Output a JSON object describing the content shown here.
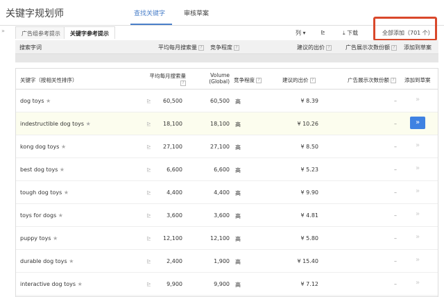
{
  "app": {
    "title": "关键字规划师",
    "nav": [
      "查找关键字",
      "审核草案"
    ]
  },
  "subtabs": [
    "广告组参考提示",
    "关键字参考提示"
  ],
  "toolbar": {
    "columns": "列 ▾",
    "chart_icon": "chart-icon",
    "download": "下载",
    "add_all": "全部添加（701 个）"
  },
  "summary_headers": {
    "term": "搜索字词",
    "avg": "平均每月搜索量",
    "competition": "竞争程度",
    "bid": "建议的出价",
    "share": "广告展示次数份额",
    "add": "添加到草案"
  },
  "table_headers": {
    "keyword": "关键字（按相关性排序）",
    "avg": "平均每月搜索量",
    "volume": "Volume (Global)",
    "competition": "竞争程度",
    "bid": "建议的出价",
    "share": "广告展示次数份额",
    "add": "添加到草案"
  },
  "help": "?",
  "rows": [
    {
      "keyword": "dog toys",
      "avg": "60,500",
      "volume": "60,500",
      "competition": "高",
      "bid": "¥ 8.39",
      "share": "–"
    },
    {
      "keyword": "indestructible dog toys",
      "avg": "18,100",
      "volume": "18,100",
      "competition": "高",
      "bid": "¥ 10.26",
      "share": "–",
      "highlighted": true
    },
    {
      "keyword": "kong dog toys",
      "avg": "27,100",
      "volume": "27,100",
      "competition": "高",
      "bid": "¥ 8.50",
      "share": "–"
    },
    {
      "keyword": "best dog toys",
      "avg": "6,600",
      "volume": "6,600",
      "competition": "高",
      "bid": "¥ 5.23",
      "share": "–"
    },
    {
      "keyword": "tough dog toys",
      "avg": "4,400",
      "volume": "4,400",
      "competition": "高",
      "bid": "¥ 9.90",
      "share": "–"
    },
    {
      "keyword": "toys for dogs",
      "avg": "3,600",
      "volume": "3,600",
      "competition": "高",
      "bid": "¥ 4.81",
      "share": "–"
    },
    {
      "keyword": "puppy toys",
      "avg": "12,100",
      "volume": "12,100",
      "competition": "高",
      "bid": "¥ 5.80",
      "share": "–"
    },
    {
      "keyword": "durable dog toys",
      "avg": "2,400",
      "volume": "1,900",
      "competition": "高",
      "bid": "¥ 15.40",
      "share": "–"
    },
    {
      "keyword": "interactive dog toys",
      "avg": "9,900",
      "volume": "9,900",
      "competition": "高",
      "bid": "¥ 7.12",
      "share": "–"
    }
  ],
  "colors": {
    "accent": "#4a7fc9",
    "add_button": "#3f82e2",
    "highlight_box": "#d9482b",
    "highlight_row": "#fcfdee"
  }
}
